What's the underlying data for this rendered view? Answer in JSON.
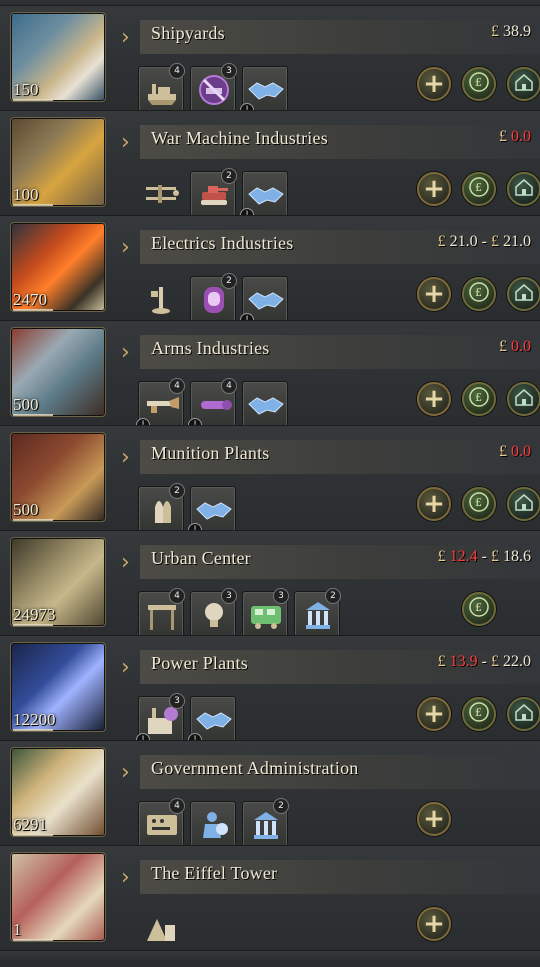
{
  "buildings": [
    {
      "id": "shipyards",
      "name": "Shipyards",
      "level": "150",
      "money": {
        "currency": "£",
        "low": "38.9",
        "low_negative": false,
        "high": null
      },
      "slots": [
        {
          "icon": "factory-ship-icon",
          "count": "4",
          "warn": false
        },
        {
          "icon": "banned-ship-icon",
          "count": "3",
          "warn": false
        },
        {
          "icon": "handshake-icon",
          "count": null,
          "warn": true
        }
      ],
      "buttons": [
        "expand",
        "finance",
        "home"
      ]
    },
    {
      "id": "war-machine-industries",
      "name": "War Machine Industries",
      "level": "100",
      "money": {
        "currency": "£",
        "low": "0.0",
        "low_negative": true,
        "high": null
      },
      "slots": [
        {
          "icon": "biplane-icon",
          "count": null,
          "warn": false,
          "plain": true
        },
        {
          "icon": "tank-icon",
          "count": "2",
          "warn": false
        },
        {
          "icon": "handshake-icon",
          "count": null,
          "warn": true
        }
      ],
      "buttons": [
        "expand",
        "finance",
        "home"
      ]
    },
    {
      "id": "electrics-industries",
      "name": "Electrics Industries",
      "level": "2470",
      "money": {
        "currency": "£",
        "low": "21.0",
        "low_negative": false,
        "high": "21.0"
      },
      "slots": [
        {
          "icon": "telephone-icon",
          "count": null,
          "warn": false,
          "plain": true
        },
        {
          "icon": "radio-icon",
          "count": "2",
          "warn": false
        },
        {
          "icon": "handshake-icon",
          "count": null,
          "warn": true
        }
      ],
      "buttons": [
        "expand",
        "finance",
        "home"
      ]
    },
    {
      "id": "arms-industries",
      "name": "Arms Industries",
      "level": "500",
      "money": {
        "currency": "£",
        "low": "0.0",
        "low_negative": true,
        "high": null
      },
      "slots": [
        {
          "icon": "rifle-icon",
          "count": "4",
          "warn": true
        },
        {
          "icon": "artillery-icon",
          "count": "4",
          "warn": true
        },
        {
          "icon": "handshake-icon",
          "count": null,
          "warn": false
        }
      ],
      "buttons": [
        "expand",
        "finance",
        "home"
      ]
    },
    {
      "id": "munition-plants",
      "name": "Munition Plants",
      "level": "500",
      "money": {
        "currency": "£",
        "low": "0.0",
        "low_negative": true,
        "high": null
      },
      "slots": [
        {
          "icon": "ammunition-icon",
          "count": "2",
          "warn": false
        },
        {
          "icon": "handshake-icon",
          "count": null,
          "warn": true
        }
      ],
      "buttons": [
        "expand",
        "finance",
        "home"
      ]
    },
    {
      "id": "urban-center",
      "name": "Urban Center",
      "level": "24973",
      "money": {
        "currency": "£",
        "low": "12.4",
        "low_negative": true,
        "high": "18.6"
      },
      "slots": [
        {
          "icon": "market-stall-icon",
          "count": "4",
          "warn": false
        },
        {
          "icon": "lightbulb-icon",
          "count": "3",
          "warn": false
        },
        {
          "icon": "tram-icon",
          "count": "3",
          "warn": false
        },
        {
          "icon": "government-icon",
          "count": "2",
          "warn": false
        }
      ],
      "buttons": [
        "finance"
      ]
    },
    {
      "id": "power-plants",
      "name": "Power Plants",
      "level": "12200",
      "money": {
        "currency": "£",
        "low": "13.9",
        "low_negative": true,
        "high": "22.0"
      },
      "slots": [
        {
          "icon": "power-plant-icon",
          "count": "3",
          "warn": true
        },
        {
          "icon": "handshake-icon",
          "count": null,
          "warn": true
        }
      ],
      "buttons": [
        "expand",
        "finance",
        "home"
      ]
    },
    {
      "id": "government-administration",
      "name": "Government Administration",
      "level": "6291",
      "money": null,
      "slots": [
        {
          "icon": "control-panel-icon",
          "count": "4",
          "warn": false
        },
        {
          "icon": "bureaucrat-icon",
          "count": null,
          "warn": false
        },
        {
          "icon": "government-icon",
          "count": "2",
          "warn": false
        }
      ],
      "buttons": [
        "expand"
      ]
    },
    {
      "id": "eiffel-tower",
      "name": "The Eiffel Tower",
      "level": "1",
      "money": null,
      "slots": [
        {
          "icon": "monument-icon",
          "count": null,
          "warn": false,
          "plain": true
        }
      ],
      "buttons": [
        "expand"
      ]
    }
  ],
  "ui": {
    "accent": "#c7a86a",
    "negative": "#ff3b3b",
    "warn_glyph": "!"
  }
}
